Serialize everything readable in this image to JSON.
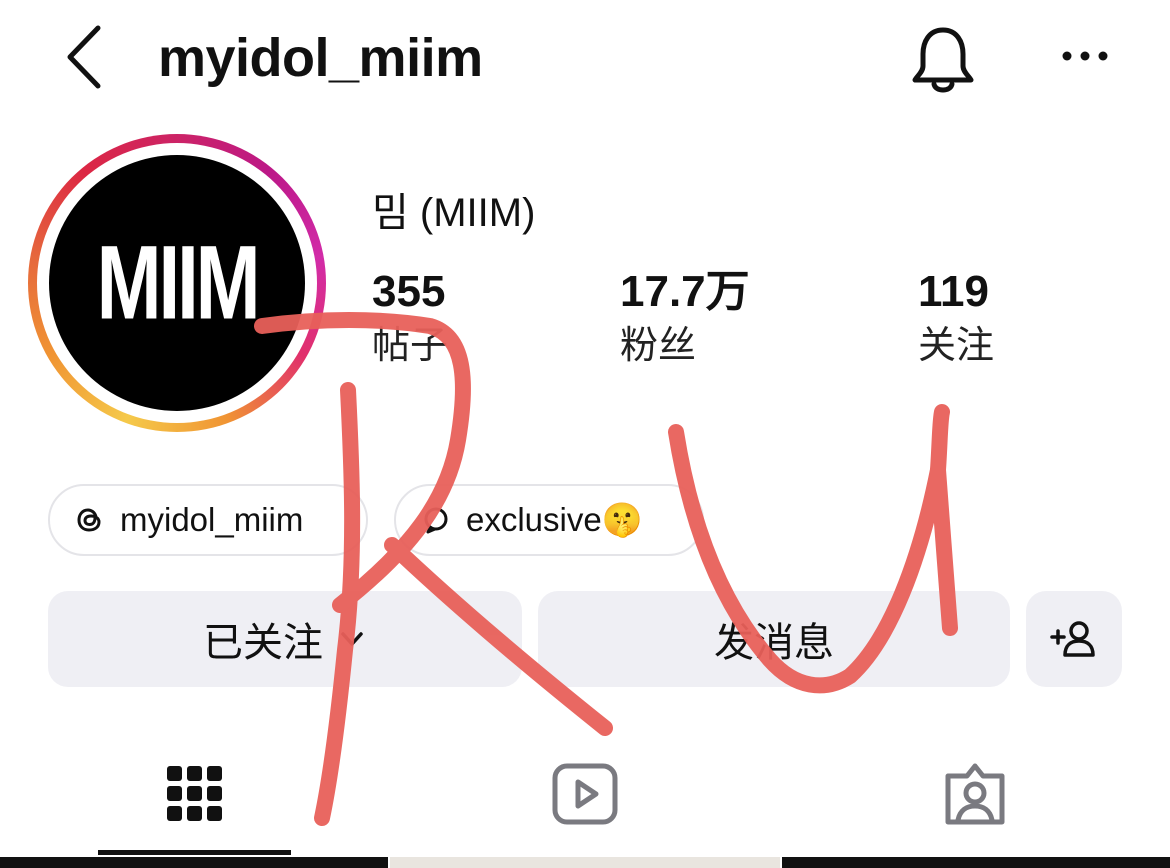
{
  "header": {
    "title": "myidol_miim",
    "back_icon": "chevron-left-icon",
    "notification_icon": "bell-icon",
    "more_icon": "more-horizontal-icon"
  },
  "profile": {
    "avatar_logo_text": "MIIM",
    "display_name": "밈 (MIIM)",
    "stats": {
      "posts": {
        "value": "355",
        "label": "帖子"
      },
      "followers": {
        "value": "17.7万",
        "label": "粉丝"
      },
      "following": {
        "value": "119",
        "label": "关注"
      }
    }
  },
  "links": [
    {
      "icon": "threads-icon",
      "label": "myidol_miim"
    },
    {
      "icon": "broadcast-channel-icon",
      "label": "exclusive🤫"
    }
  ],
  "actions": {
    "following_label": "已关注",
    "following_icon": "chevron-down-icon",
    "message_label": "发消息",
    "add_user_icon": "add-user-icon"
  },
  "tabs": [
    {
      "name": "posts",
      "icon": "grid-icon",
      "active": true
    },
    {
      "name": "reels",
      "icon": "reels-icon",
      "active": false
    },
    {
      "name": "tagged",
      "icon": "tagged-icon",
      "active": false
    }
  ],
  "overlay": {
    "handwritten_text": "RU",
    "color": "#e8605a"
  },
  "colors": {
    "button_bg": "#efeff4",
    "chip_border": "#e4e4e8",
    "text": "#111111"
  }
}
